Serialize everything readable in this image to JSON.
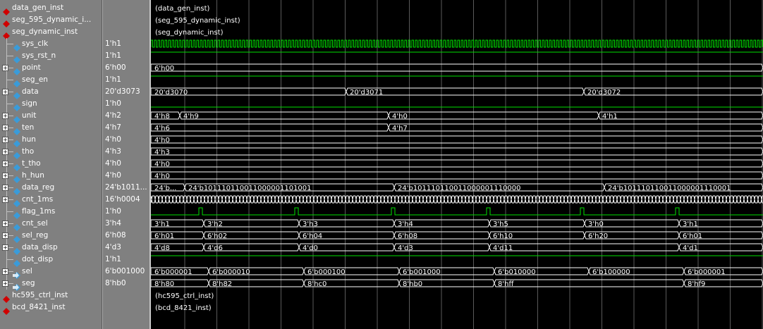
{
  "rows": [
    {
      "name": "data_gen_inst",
      "value": "",
      "kind": "inst"
    },
    {
      "name": "seg_595_dynamic_i...",
      "value": "",
      "kind": "inst"
    },
    {
      "name": "seg_dynamic_inst",
      "value": "",
      "kind": "inst"
    },
    {
      "name": "sys_clk",
      "value": "1'h1",
      "kind": "in"
    },
    {
      "name": "sys_rst_n",
      "value": "1'h1",
      "kind": "in"
    },
    {
      "name": "point",
      "value": "6'h00",
      "kind": "in",
      "bus": true
    },
    {
      "name": "seg_en",
      "value": "1'h1",
      "kind": "in"
    },
    {
      "name": "data",
      "value": "20'd3073",
      "kind": "in",
      "bus": true
    },
    {
      "name": "sign",
      "value": "1'h0",
      "kind": "in"
    },
    {
      "name": "unit",
      "value": "4'h2",
      "kind": "int",
      "bus": true
    },
    {
      "name": "ten",
      "value": "4'h7",
      "kind": "int",
      "bus": true
    },
    {
      "name": "hun",
      "value": "4'h0",
      "kind": "int",
      "bus": true
    },
    {
      "name": "tho",
      "value": "4'h3",
      "kind": "int",
      "bus": true
    },
    {
      "name": "t_tho",
      "value": "4'h0",
      "kind": "int",
      "bus": true
    },
    {
      "name": "h_hun",
      "value": "4'h0",
      "kind": "int",
      "bus": true
    },
    {
      "name": "data_reg",
      "value": "24'b1011...",
      "kind": "int",
      "bus": true
    },
    {
      "name": "cnt_1ms",
      "value": "16'h0004",
      "kind": "int",
      "bus": true
    },
    {
      "name": "flag_1ms",
      "value": "1'h0",
      "kind": "int"
    },
    {
      "name": "cnt_sel",
      "value": "3'h4",
      "kind": "int",
      "bus": true
    },
    {
      "name": "sel_reg",
      "value": "6'h08",
      "kind": "int",
      "bus": true
    },
    {
      "name": "data_disp",
      "value": "4'd3",
      "kind": "int",
      "bus": true
    },
    {
      "name": "dot_disp",
      "value": "1'h1",
      "kind": "int"
    },
    {
      "name": "sel",
      "value": "6'b001000",
      "kind": "out",
      "bus": true
    },
    {
      "name": "seg",
      "value": "8'hb0",
      "kind": "out",
      "bus": true
    },
    {
      "name": "hc595_ctrl_inst",
      "value": "",
      "kind": "inst"
    },
    {
      "name": "bcd_8421_inst",
      "value": "",
      "kind": "inst"
    }
  ],
  "waves": [
    {
      "type": "label",
      "text": "(data_gen_inst)"
    },
    {
      "type": "label",
      "text": "(seg_595_dynamic_inst)"
    },
    {
      "type": "label",
      "text": "(seg_dynamic_inst)"
    },
    {
      "type": "clock"
    },
    {
      "type": "high"
    },
    {
      "type": "bus",
      "segs": [
        [
          0,
          "6'h00"
        ]
      ]
    },
    {
      "type": "high"
    },
    {
      "type": "bus",
      "segs": [
        [
          0,
          "20'd3070"
        ],
        [
          277,
          "20'd3071"
        ],
        [
          614,
          "20'd3072"
        ]
      ]
    },
    {
      "type": "low"
    },
    {
      "type": "bus",
      "segs": [
        [
          0,
          "4'h8"
        ],
        [
          41,
          "4'h9"
        ],
        [
          337,
          "4'h0"
        ],
        [
          635,
          "4'h1"
        ]
      ]
    },
    {
      "type": "bus",
      "segs": [
        [
          0,
          "4'h6"
        ],
        [
          337,
          "4'h7"
        ]
      ]
    },
    {
      "type": "bus",
      "segs": [
        [
          0,
          "4'h0"
        ]
      ]
    },
    {
      "type": "bus",
      "segs": [
        [
          0,
          "4'h3"
        ]
      ]
    },
    {
      "type": "bus",
      "segs": [
        [
          0,
          "4'h0"
        ]
      ]
    },
    {
      "type": "bus",
      "segs": [
        [
          0,
          "4'h0"
        ]
      ]
    },
    {
      "type": "bus",
      "segs": [
        [
          0,
          "24'b..."
        ],
        [
          48,
          "24'b101110110011000001101001"
        ],
        [
          345,
          "24'b101110110011000001110000"
        ],
        [
          643,
          "24'b101110110011000001110001"
        ]
      ]
    },
    {
      "type": "dense"
    },
    {
      "type": "pulse",
      "at": [
        68,
        204,
        341,
        476,
        609,
        744
      ]
    },
    {
      "type": "bus",
      "segs": [
        [
          0,
          "3'h1"
        ],
        [
          75,
          "3'h2"
        ],
        [
          210,
          "3'h3"
        ],
        [
          345,
          "3'h4"
        ],
        [
          480,
          "3'h5"
        ],
        [
          615,
          "3'h0"
        ],
        [
          749,
          "3'h1"
        ]
      ]
    },
    {
      "type": "bus",
      "segs": [
        [
          0,
          "6'h01"
        ],
        [
          75,
          "6'h02"
        ],
        [
          210,
          "6'h04"
        ],
        [
          345,
          "6'h08"
        ],
        [
          480,
          "6'h10"
        ],
        [
          615,
          "6'h20"
        ],
        [
          749,
          "6'h01"
        ]
      ]
    },
    {
      "type": "bus",
      "segs": [
        [
          0,
          "4'd8"
        ],
        [
          75,
          "4'd6"
        ],
        [
          210,
          "4'd0"
        ],
        [
          345,
          "4'd3"
        ],
        [
          480,
          "4'd11"
        ],
        [
          749,
          "4'd1"
        ]
      ]
    },
    {
      "type": "high"
    },
    {
      "type": "bus",
      "segs": [
        [
          0,
          "6'b000001"
        ],
        [
          82,
          "6'b000010"
        ],
        [
          217,
          "6'b000100"
        ],
        [
          352,
          "6'b001000"
        ],
        [
          487,
          "6'b010000"
        ],
        [
          621,
          "6'b100000"
        ],
        [
          756,
          "6'b000001"
        ]
      ]
    },
    {
      "type": "bus",
      "segs": [
        [
          0,
          "8'h80"
        ],
        [
          82,
          "8'h82"
        ],
        [
          217,
          "8'hc0"
        ],
        [
          352,
          "8'hb0"
        ],
        [
          487,
          "8'hff"
        ],
        [
          756,
          "8'hf9"
        ]
      ]
    },
    {
      "type": "label",
      "text": "(hc595_ctrl_inst)"
    },
    {
      "type": "label",
      "text": "(bcd_8421_inst)"
    }
  ],
  "colors": {
    "wave": "#00e000",
    "grid": "#5a5a5a",
    "bus": "#ffffff",
    "inst": "#d00000",
    "port": "#3a9bd9"
  }
}
